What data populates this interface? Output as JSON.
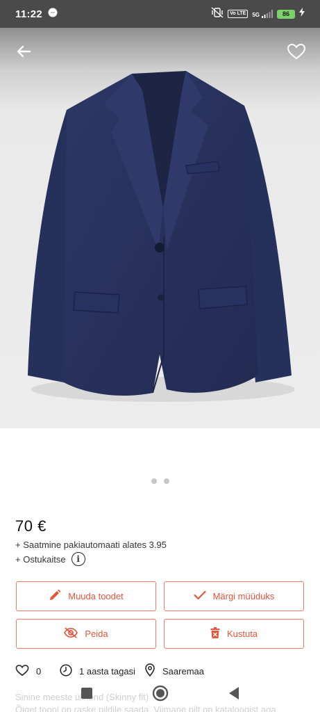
{
  "status_bar": {
    "time": "11:22",
    "network_badge_1": "Vo LTE",
    "network_badge_2": "5G",
    "battery": "86",
    "icons": [
      "messenger-icon",
      "mute-vibrate-icon",
      "volte-icon",
      "5g-signal-icon",
      "battery-icon",
      "charging-icon"
    ]
  },
  "hero": {
    "icons": {
      "back": "arrow-left-icon",
      "favorite": "heart-outline-icon"
    },
    "image": "navy-blazer-photo",
    "image_count": 2,
    "active_index": 0
  },
  "listing": {
    "price": "70 €",
    "shipping": "+ Saatmine pakiautomaati alates 3.95",
    "protection": "+ Ostukaitse",
    "info_symbol": "i"
  },
  "actions": {
    "edit": "Muuda toodet",
    "mark_sold": "Märgi müüduks",
    "hide": "Peida",
    "delete": "Kustuta"
  },
  "meta": {
    "likes": "0",
    "age": "1 aasta tagasi",
    "location": "Saaremaa"
  },
  "description": {
    "line1": "Sinine meeste ülikond (Skinny fit)",
    "line2": "Õiget tooni on raske pildile saada. Viimane pilt on kataloogist aga"
  },
  "colors": {
    "accent": "#e4553c",
    "accent_border": "#ee7a63",
    "status_bar": "#4a4a4a",
    "battery": "#7bd46b"
  }
}
